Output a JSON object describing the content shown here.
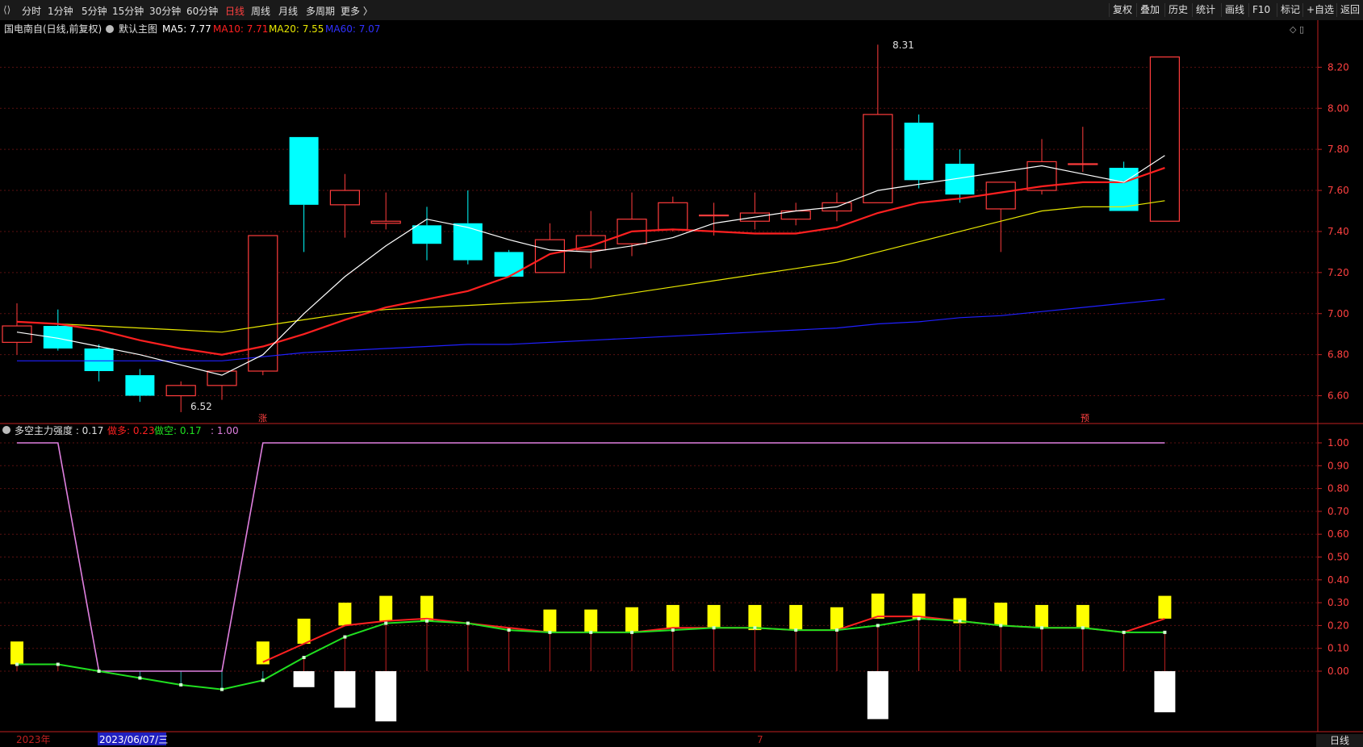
{
  "toolbar": {
    "periods": [
      "分时",
      "1分钟",
      "5分钟",
      "15分钟",
      "30分钟",
      "60分钟",
      "日线",
      "周线",
      "月线",
      "多周期",
      "更多 〉"
    ],
    "active_period": "日线",
    "right_buttons": [
      "复权",
      "叠加",
      "历史",
      "统计",
      "画线",
      "F10",
      "标记",
      "+自选",
      "返回"
    ]
  },
  "main_panel": {
    "title": "国电南自(日线,前复权)",
    "chart_name": "默认主图",
    "ma5_label": "MA5: 7.77",
    "ma10_label": "MA10: 7.71",
    "ma20_label": "MA20: 7.55",
    "ma60_label": "MA60: 7.07",
    "high_marker": "8.31",
    "low_marker": "6.52",
    "marker_zhang": "涨",
    "marker_yu": "预"
  },
  "sub_panel": {
    "indicator_label": "多空主力强度 : 0.17",
    "long_label": "做多: 0.23",
    "short_label": "做空: 0.17",
    "value_label": ": 1.00"
  },
  "x_axis": {
    "year_label": "2023年",
    "cursor_date": "2023/06/07/三",
    "month_label": "7"
  },
  "bottom_timeframe": "日线",
  "colors": {
    "up": "#ff3c3c",
    "down": "#00ffff",
    "ma5": "#ffffff",
    "ma10": "#ff2020",
    "ma20": "#e8e800",
    "ma60": "#2020ff",
    "strength_line": "#e080e0",
    "long_line": "#ff2020",
    "short_line": "#20e020",
    "long_bar": "#ffff00",
    "short_bar": "#ffffff",
    "axis": "#c02020"
  },
  "chart_data": {
    "type": "candlestick",
    "price_axis_ticks": [
      6.6,
      6.8,
      7.0,
      7.2,
      7.4,
      7.6,
      7.8,
      8.0,
      8.2
    ],
    "indicator_axis_ticks": [
      0.0,
      0.1,
      0.2,
      0.3,
      0.4,
      0.5,
      0.6,
      0.7,
      0.8,
      0.9,
      1.0
    ],
    "candles": [
      {
        "o": 6.86,
        "h": 7.05,
        "l": 6.8,
        "c": 6.94
      },
      {
        "o": 6.94,
        "h": 7.02,
        "l": 6.82,
        "c": 6.83
      },
      {
        "o": 6.83,
        "h": 6.85,
        "l": 6.67,
        "c": 6.72
      },
      {
        "o": 6.7,
        "h": 6.73,
        "l": 6.57,
        "c": 6.6
      },
      {
        "o": 6.6,
        "h": 6.67,
        "l": 6.52,
        "c": 6.65
      },
      {
        "o": 6.65,
        "h": 6.72,
        "l": 6.58,
        "c": 6.72
      },
      {
        "o": 6.72,
        "h": 7.38,
        "l": 6.7,
        "c": 7.38
      },
      {
        "o": 7.86,
        "h": 7.86,
        "l": 7.3,
        "c": 7.53
      },
      {
        "o": 7.53,
        "h": 7.68,
        "l": 7.37,
        "c": 7.6
      },
      {
        "o": 7.44,
        "h": 7.59,
        "l": 7.41,
        "c": 7.45
      },
      {
        "o": 7.43,
        "h": 7.52,
        "l": 7.26,
        "c": 7.34
      },
      {
        "o": 7.44,
        "h": 7.6,
        "l": 7.24,
        "c": 7.26
      },
      {
        "o": 7.3,
        "h": 7.31,
        "l": 7.18,
        "c": 7.18
      },
      {
        "o": 7.2,
        "h": 7.44,
        "l": 7.2,
        "c": 7.36
      },
      {
        "o": 7.31,
        "h": 7.5,
        "l": 7.22,
        "c": 7.38
      },
      {
        "o": 7.34,
        "h": 7.59,
        "l": 7.28,
        "c": 7.46
      },
      {
        "o": 7.41,
        "h": 7.57,
        "l": 7.4,
        "c": 7.54
      },
      {
        "o": 7.48,
        "h": 7.54,
        "l": 7.38,
        "c": 7.48
      },
      {
        "o": 7.45,
        "h": 7.59,
        "l": 7.41,
        "c": 7.49
      },
      {
        "o": 7.46,
        "h": 7.54,
        "l": 7.43,
        "c": 7.5
      },
      {
        "o": 7.5,
        "h": 7.59,
        "l": 7.45,
        "c": 7.54
      },
      {
        "o": 7.54,
        "h": 8.31,
        "l": 7.54,
        "c": 7.97
      },
      {
        "o": 7.93,
        "h": 7.97,
        "l": 7.61,
        "c": 7.65
      },
      {
        "o": 7.73,
        "h": 7.8,
        "l": 7.54,
        "c": 7.58
      },
      {
        "o": 7.51,
        "h": 7.64,
        "l": 7.3,
        "c": 7.64
      },
      {
        "o": 7.6,
        "h": 7.85,
        "l": 7.58,
        "c": 7.74
      },
      {
        "o": 7.73,
        "h": 7.91,
        "l": 7.69,
        "c": 7.73
      },
      {
        "o": 7.71,
        "h": 7.74,
        "l": 7.5,
        "c": 7.5
      },
      {
        "o": 7.45,
        "h": 8.25,
        "l": 7.45,
        "c": 8.25
      }
    ],
    "ma5": [
      6.91,
      6.88,
      6.84,
      6.8,
      6.75,
      6.7,
      6.8,
      7.0,
      7.18,
      7.33,
      7.46,
      7.42,
      7.36,
      7.31,
      7.3,
      7.33,
      7.37,
      7.44,
      7.47,
      7.5,
      7.52,
      7.6,
      7.63,
      7.66,
      7.69,
      7.72,
      7.68,
      7.64,
      7.77
    ],
    "ma10": [
      6.96,
      6.95,
      6.92,
      6.87,
      6.83,
      6.8,
      6.84,
      6.9,
      6.97,
      7.03,
      7.07,
      7.11,
      7.18,
      7.29,
      7.33,
      7.4,
      7.41,
      7.4,
      7.39,
      7.39,
      7.42,
      7.49,
      7.54,
      7.56,
      7.59,
      7.62,
      7.64,
      7.64,
      7.71
    ],
    "ma20": [
      6.96,
      6.95,
      6.94,
      6.93,
      6.92,
      6.91,
      6.94,
      6.97,
      7.0,
      7.02,
      7.03,
      7.04,
      7.05,
      7.06,
      7.07,
      7.1,
      7.13,
      7.16,
      7.19,
      7.22,
      7.25,
      7.3,
      7.35,
      7.4,
      7.45,
      7.5,
      7.52,
      7.52,
      7.55
    ],
    "ma60": [
      6.77,
      6.77,
      6.77,
      6.77,
      6.77,
      6.77,
      6.79,
      6.81,
      6.82,
      6.83,
      6.84,
      6.85,
      6.85,
      6.86,
      6.87,
      6.88,
      6.89,
      6.9,
      6.91,
      6.92,
      6.93,
      6.95,
      6.96,
      6.98,
      6.99,
      7.01,
      7.03,
      7.05,
      7.07
    ],
    "strength_line": [
      1.0,
      1.0,
      0.0,
      0.0,
      0.0,
      0.0,
      1.0,
      1.0,
      1.0,
      1.0,
      1.0,
      1.0,
      1.0,
      1.0,
      1.0,
      1.0,
      1.0,
      1.0,
      1.0,
      1.0,
      1.0,
      1.0,
      1.0,
      1.0,
      1.0,
      1.0,
      1.0,
      1.0,
      1.0
    ],
    "long_line": [
      null,
      null,
      null,
      null,
      null,
      null,
      0.04,
      0.12,
      0.2,
      0.22,
      0.23,
      0.21,
      0.19,
      0.17,
      0.17,
      0.17,
      0.19,
      0.19,
      0.19,
      0.18,
      0.18,
      0.24,
      0.24,
      0.22,
      0.2,
      0.19,
      0.19,
      0.17,
      0.23
    ],
    "short_line": [
      0.03,
      0.03,
      0.0,
      -0.03,
      -0.06,
      -0.08,
      -0.04,
      0.06,
      0.15,
      0.21,
      0.22,
      0.21,
      0.18,
      0.17,
      0.17,
      0.17,
      0.18,
      0.19,
      0.19,
      0.18,
      0.18,
      0.2,
      0.23,
      0.22,
      0.2,
      0.19,
      0.19,
      0.17,
      0.17
    ],
    "long_bars": [
      [
        0.03,
        0.13
      ],
      null,
      null,
      null,
      null,
      null,
      [
        0.03,
        0.13
      ],
      [
        0.12,
        0.23
      ],
      [
        0.2,
        0.3
      ],
      [
        0.22,
        0.33
      ],
      [
        0.22,
        0.33
      ],
      null,
      null,
      [
        0.17,
        0.27
      ],
      [
        0.17,
        0.27
      ],
      [
        0.17,
        0.28
      ],
      [
        0.19,
        0.29
      ],
      [
        0.19,
        0.29
      ],
      [
        0.18,
        0.29
      ],
      [
        0.18,
        0.29
      ],
      [
        0.18,
        0.28
      ],
      [
        0.23,
        0.34
      ],
      [
        0.23,
        0.34
      ],
      [
        0.21,
        0.32
      ],
      [
        0.2,
        0.3
      ],
      [
        0.19,
        0.29
      ],
      [
        0.19,
        0.29
      ],
      null,
      [
        0.23,
        0.33
      ]
    ],
    "short_bars": [
      null,
      null,
      null,
      null,
      null,
      null,
      null,
      [
        -0.07,
        0.0
      ],
      [
        -0.16,
        0.0
      ],
      [
        -0.22,
        0.0
      ],
      null,
      null,
      null,
      null,
      null,
      null,
      null,
      null,
      null,
      null,
      null,
      [
        -0.21,
        0.0
      ],
      null,
      null,
      null,
      null,
      null,
      null,
      [
        -0.18,
        0.0
      ]
    ]
  }
}
